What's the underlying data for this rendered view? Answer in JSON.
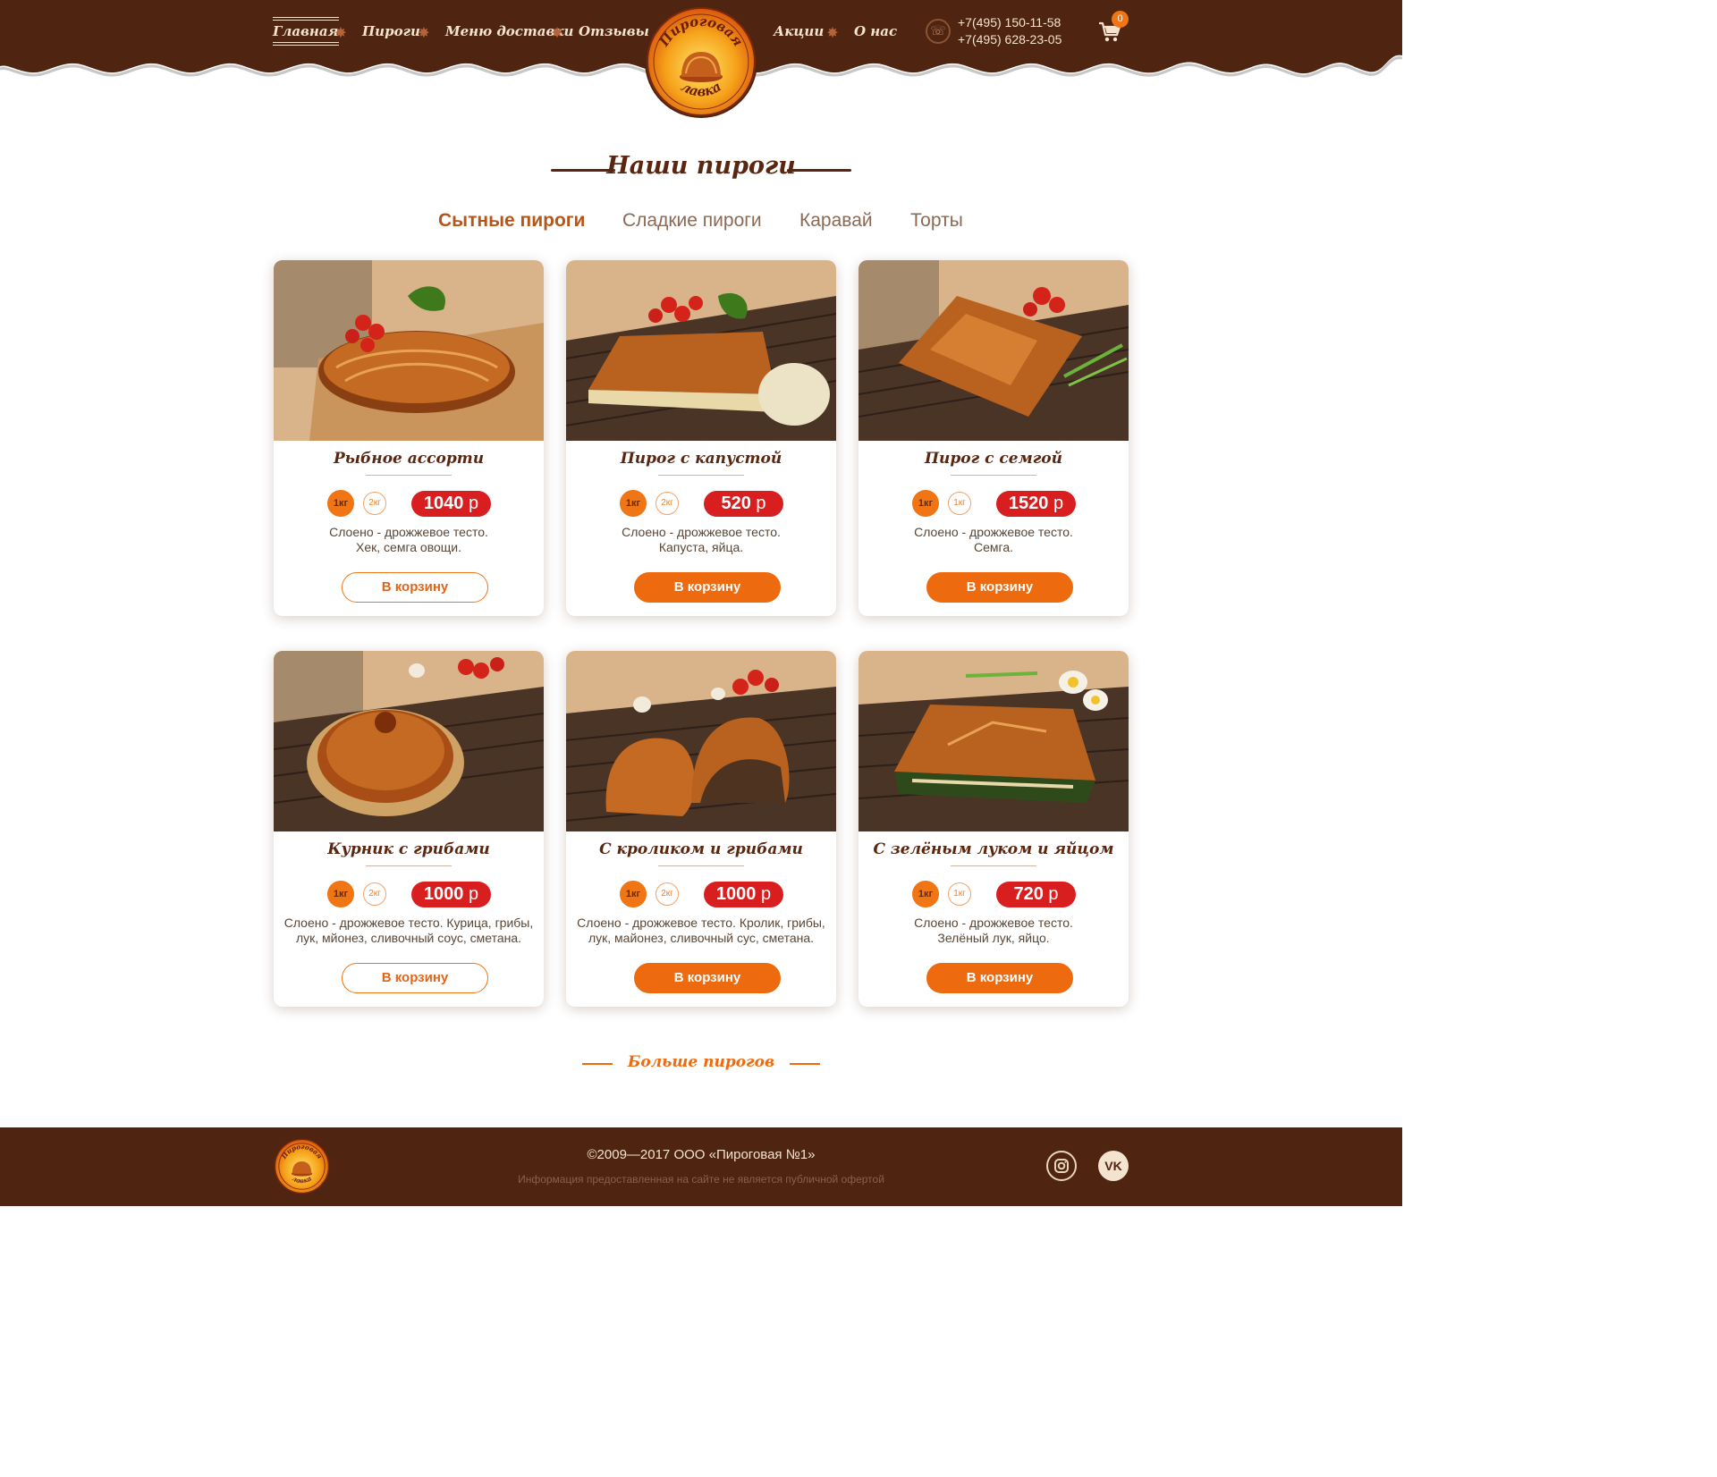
{
  "colors": {
    "header_brown": "#4f2411",
    "accent_orange": "#ee6a0f",
    "price_red": "#d81e1e",
    "title_brown": "#5a2610"
  },
  "nav": {
    "items": [
      {
        "label": "Главная",
        "active": true
      },
      {
        "label": "Пироги"
      },
      {
        "label": "Меню доставки"
      },
      {
        "label": "Отзывы"
      },
      {
        "label": "Акции"
      },
      {
        "label": "О нас"
      }
    ],
    "separator_icon": "star-icon"
  },
  "logo": {
    "alt": "Пироговая лавка",
    "top_text": "Пироговая",
    "bottom_text": "лавка"
  },
  "contacts": {
    "phone_icon": "phone-icon",
    "phones": [
      "+7(495) 150-11-58",
      "+7(495) 628-23-05"
    ]
  },
  "cart": {
    "icon": "cart-icon",
    "count": "0"
  },
  "section": {
    "title": "Наши пироги"
  },
  "tabs": [
    {
      "label": "Сытные пироги",
      "active": true
    },
    {
      "label": "Сладкие пироги"
    },
    {
      "label": "Каравай"
    },
    {
      "label": "Торты"
    }
  ],
  "products": [
    {
      "title": "Рыбное ассорти",
      "weights": [
        "1кг",
        "2кг"
      ],
      "price": "1040",
      "currency": "р",
      "desc_line1": "Слоено - дрожжевое тесто.",
      "desc_line2": "Хек, семга овощи.",
      "button": "В корзину",
      "button_style": "outline"
    },
    {
      "title": "Пирог с капустой",
      "weights": [
        "1кг",
        "2кг"
      ],
      "price": "520",
      "currency": "р",
      "desc_line1": "Слоено - дрожжевое тесто.",
      "desc_line2": "Капуста, яйца.",
      "button": "В корзину",
      "button_style": "solid"
    },
    {
      "title": "Пирог с семгой",
      "weights": [
        "1кг",
        "1кг"
      ],
      "price": "1520",
      "currency": "р",
      "desc_line1": "Слоено - дрожжевое тесто.",
      "desc_line2": "Семга.",
      "button": "В корзину",
      "button_style": "solid"
    },
    {
      "title": "Курник с грибами",
      "weights": [
        "1кг",
        "2кг"
      ],
      "price": "1000",
      "currency": "р",
      "desc_line1": "Слоено - дрожжевое тесто. Курица, грибы,",
      "desc_line2": "лук, мйонез, сливочный соус, сметана.",
      "button": "В корзину",
      "button_style": "outline"
    },
    {
      "title": "С кроликом и грибами",
      "weights": [
        "1кг",
        "2кг"
      ],
      "price": "1000",
      "currency": "р",
      "desc_line1": "Слоено - дрожжевое тесто. Кролик, грибы,",
      "desc_line2": "лук, майонез, сливочный сус, сметана.",
      "button": "В корзину",
      "button_style": "solid"
    },
    {
      "title": "С зелёным луком и яйцом",
      "weights": [
        "1кг",
        "1кг"
      ],
      "price": "720",
      "currency": "р",
      "desc_line1": "Слоено - дрожжевое тесто.",
      "desc_line2": "Зелёный лук, яйцо.",
      "button": "В корзину",
      "button_style": "solid"
    }
  ],
  "more": {
    "label": "Больше пирогов"
  },
  "footer": {
    "copyright": "©2009—2017 ООО «Пироговая №1»",
    "disclaimer": "Информация предоставленная на сайте не является публичной офертой",
    "social": [
      {
        "icon": "instagram-icon"
      },
      {
        "icon": "vk-icon",
        "label": "VK"
      }
    ]
  }
}
